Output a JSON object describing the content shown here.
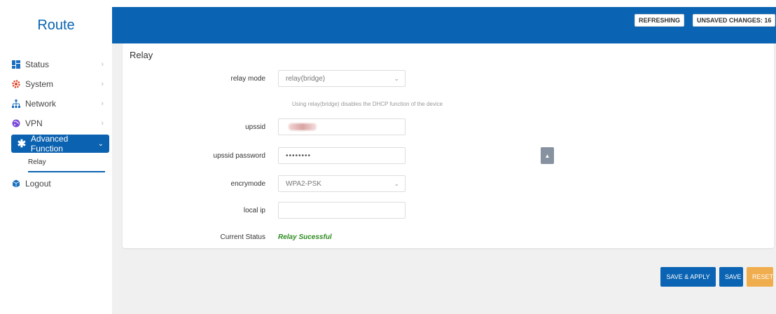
{
  "sidebar": {
    "brand": "Route",
    "items": [
      {
        "label": "Status",
        "icon": "dashboard-icon"
      },
      {
        "label": "System",
        "icon": "gear-icon"
      },
      {
        "label": "Network",
        "icon": "network-icon"
      },
      {
        "label": "VPN",
        "icon": "globe-icon"
      },
      {
        "label": "Advanced Function",
        "icon": "asterisk-icon"
      },
      {
        "label": "Logout",
        "icon": "logout-icon"
      }
    ],
    "sub_item": "Relay"
  },
  "header": {
    "refreshing": "REFRESHING",
    "unsaved": "UNSAVED CHANGES: 16"
  },
  "card": {
    "title": "Relay",
    "relay_mode_label": "relay mode",
    "relay_mode_value": "relay(bridge)",
    "hint": "Using relay(bridge) disables the DHCP function of the device",
    "upssid_label": "upssid",
    "upssid_password_label": "upssid password",
    "upssid_password_value": "••••••••",
    "encrymode_label": "encrymode",
    "encrymode_value": "WPA2-PSK",
    "local_ip_label": "local ip",
    "local_ip_value": "",
    "current_status_label": "Current Status",
    "current_status_value": "Relay Sucessful"
  },
  "actions": {
    "save_apply": "SAVE & APPLY",
    "save": "SAVE",
    "reset": "RESET"
  },
  "colors": {
    "primary": "#0a64b3",
    "reset": "#f0ad4e",
    "status_ok": "#2e8b20"
  }
}
